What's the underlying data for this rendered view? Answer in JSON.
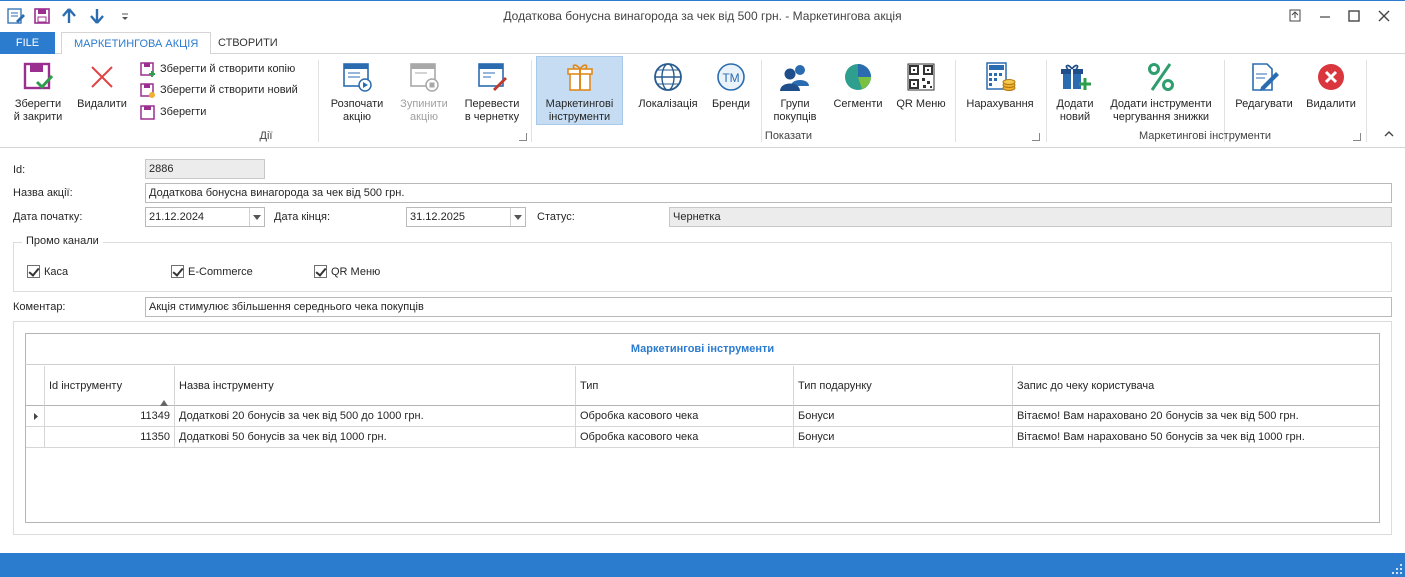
{
  "window": {
    "title": "Додаткова бонусна винагорода за чек від 500 грн. - Маркетингова акція"
  },
  "tabs": {
    "file": "FILE",
    "marketing": "МАРКЕТИНГОВА АКЦІЯ",
    "create": "СТВОРИТИ"
  },
  "ribbon": {
    "actions": {
      "save_close": [
        "Зберегти",
        "й закрити"
      ],
      "delete": "Видалити",
      "save_copy": "Зберегти й створити копію",
      "save_new": "Зберегти й створити новий",
      "save": "Зберегти",
      "start": [
        "Розпочати",
        "акцію"
      ],
      "stop": [
        "Зупинити",
        "акцію"
      ],
      "to_draft": [
        "Перевести",
        "в чернетку"
      ],
      "group_label": "Дії"
    },
    "show": {
      "marketing_tools": [
        "Маркетингові",
        "інструменти"
      ],
      "localization": "Локалізація",
      "brands": "Бренди",
      "groups": [
        "Групи",
        "покупців"
      ],
      "segments": "Сегменти",
      "qr_menu": "QR Меню",
      "accruals": "Нарахування",
      "group_label": "Показати"
    },
    "tools": {
      "add_new": [
        "Додати",
        "новий"
      ],
      "add_alt_discount": [
        "Додати інструменти",
        "чергування знижки"
      ],
      "edit": "Редагувати",
      "delete": "Видалити",
      "group_label": "Маркетингові інструменти"
    }
  },
  "form": {
    "id_label": "Id:",
    "id_value": "2886",
    "name_label": "Назва акції:",
    "name_value": "Додаткова бонусна винагорода за чек від 500 грн.",
    "start_label": "Дата початку:",
    "start_value": "21.12.2024",
    "end_label": "Дата кінця:",
    "end_value": "31.12.2025",
    "status_label": "Статус:",
    "status_value": "Чернетка",
    "promo_legend": "Промо канали",
    "channels": [
      {
        "label": "Каса",
        "checked": true
      },
      {
        "label": "E-Commerce",
        "checked": true
      },
      {
        "label": "QR Меню",
        "checked": true
      }
    ],
    "comment_label": "Коментар:",
    "comment_value": "Акція стимулює збільшення середнього чека покупців"
  },
  "grid": {
    "caption": "Маркетингові інструменти",
    "columns": [
      "Id інструменту",
      "Назва інструменту",
      "Тип",
      "Тип подарунку",
      "Запис до чеку користувача"
    ],
    "rows": [
      [
        "11349",
        "Додаткові 20 бонусів за чек від 500 до 1000 грн.",
        "Обробка касового чека",
        "Бонуси",
        "Вітаємо! Вам нараховано 20 бонусів за чек від 500 грн."
      ],
      [
        "11350",
        "Додаткові 50 бонусів за чек від 1000 грн.",
        "Обробка касового чека",
        "Бонуси",
        "Вітаємо! Вам нараховано 50 бонусів за чек від 1000 грн."
      ]
    ]
  },
  "colors": {
    "accent": "#2b7bcf",
    "active_button": "#c5dcf2"
  }
}
